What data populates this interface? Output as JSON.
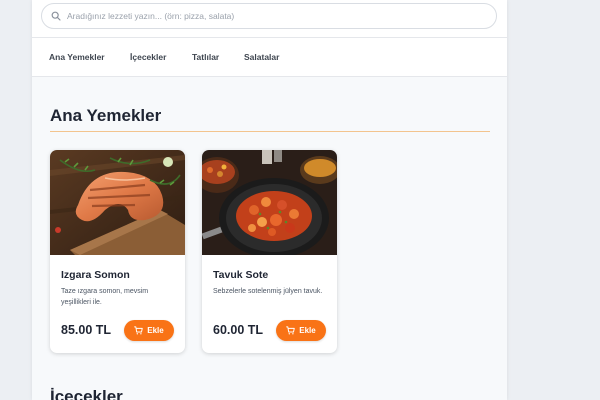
{
  "search": {
    "placeholder": "Aradığınız lezzeti yazın... (örn: pizza, salata)",
    "icon": "search-icon"
  },
  "categories": [
    {
      "label": "Ana Yemekler"
    },
    {
      "label": "İçecekler"
    },
    {
      "label": "Tatlılar"
    },
    {
      "label": "Salatalar"
    }
  ],
  "sections": [
    {
      "title": "Ana Yemekler",
      "items": [
        {
          "name": "Izgara Somon",
          "description": "Taze ızgara somon, mevsim yeşillikleri ile.",
          "price": "85.00 TL",
          "button_label": "Ekle",
          "image": "grilled-salmon-photo"
        },
        {
          "name": "Tavuk Sote",
          "description": "Sebzelerle sotelenmiş jülyen tavuk.",
          "price": "60.00 TL",
          "button_label": "Ekle",
          "image": "chicken-saute-photo"
        }
      ]
    },
    {
      "title": "İçecekler"
    }
  ],
  "colors": {
    "accent": "#f97316",
    "divider": "#f3c48e",
    "panel_bg": "#f7f9fb",
    "page_bg": "#eceff3",
    "text_dark": "#1f2533"
  }
}
